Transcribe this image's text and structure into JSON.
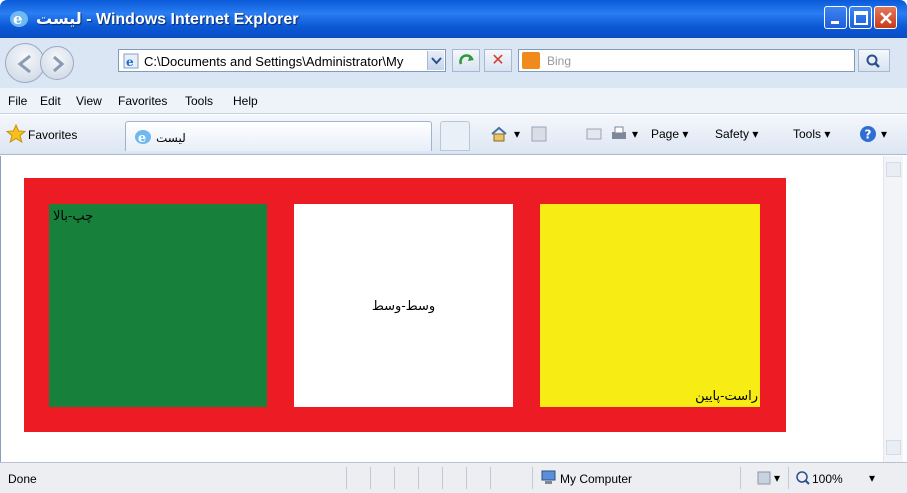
{
  "window": {
    "title": "لیست - Windows Internet Explorer"
  },
  "address": {
    "url": "C:\\Documents and Settings\\Administrator\\My"
  },
  "search": {
    "placeholder": "Bing"
  },
  "menu": [
    "File",
    "Edit",
    "View",
    "Favorites",
    "Tools",
    "Help"
  ],
  "favorites": {
    "label": "Favorites"
  },
  "tab": {
    "label": "لیست"
  },
  "commands": {
    "page": "Page ▾",
    "safety": "Safety ▾",
    "tools": "Tools ▾"
  },
  "page": {
    "cells": [
      {
        "text": "چپ-بالا",
        "color": "#17803a"
      },
      {
        "text": "وسط-وسط",
        "color": "#ffffff"
      },
      {
        "text": "راست-پایین",
        "color": "#f7ec13"
      }
    ],
    "container_color": "#ed1c24"
  },
  "status": {
    "text": "Done",
    "zone": "My Computer",
    "zoom": "100%"
  }
}
